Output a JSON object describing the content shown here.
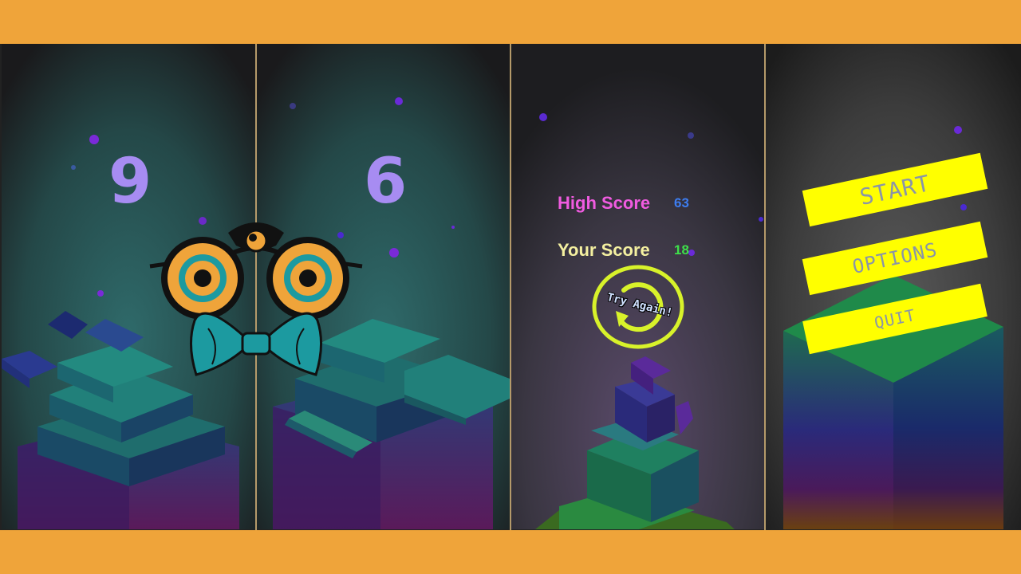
{
  "game": {
    "panels": [
      {
        "id": "gameplay-1",
        "score": "9"
      },
      {
        "id": "gameplay-2",
        "score": "6"
      },
      {
        "id": "game-over",
        "high_score_label": "High Score",
        "high_score_value": "63",
        "your_score_label": "Your Score",
        "your_score_value": "18",
        "retry_label": "Try Again!"
      },
      {
        "id": "main-menu",
        "buttons": [
          "START",
          "OPTIONS",
          "QUIT"
        ]
      }
    ]
  },
  "colors": {
    "frame": "#EFA43A",
    "score_text": "#a78cf2",
    "high_score_label": "#f05be0",
    "high_score_value": "#3d7df0",
    "your_score_label": "#f4f0a0",
    "your_score_value": "#3ee04a",
    "retry_ring": "#d8f22a",
    "menu_button": "#ffff00",
    "menu_text": "#8a95a8"
  },
  "icons": [
    "mascot-glasses-bowtie-icon",
    "retry-arrow-icon"
  ]
}
